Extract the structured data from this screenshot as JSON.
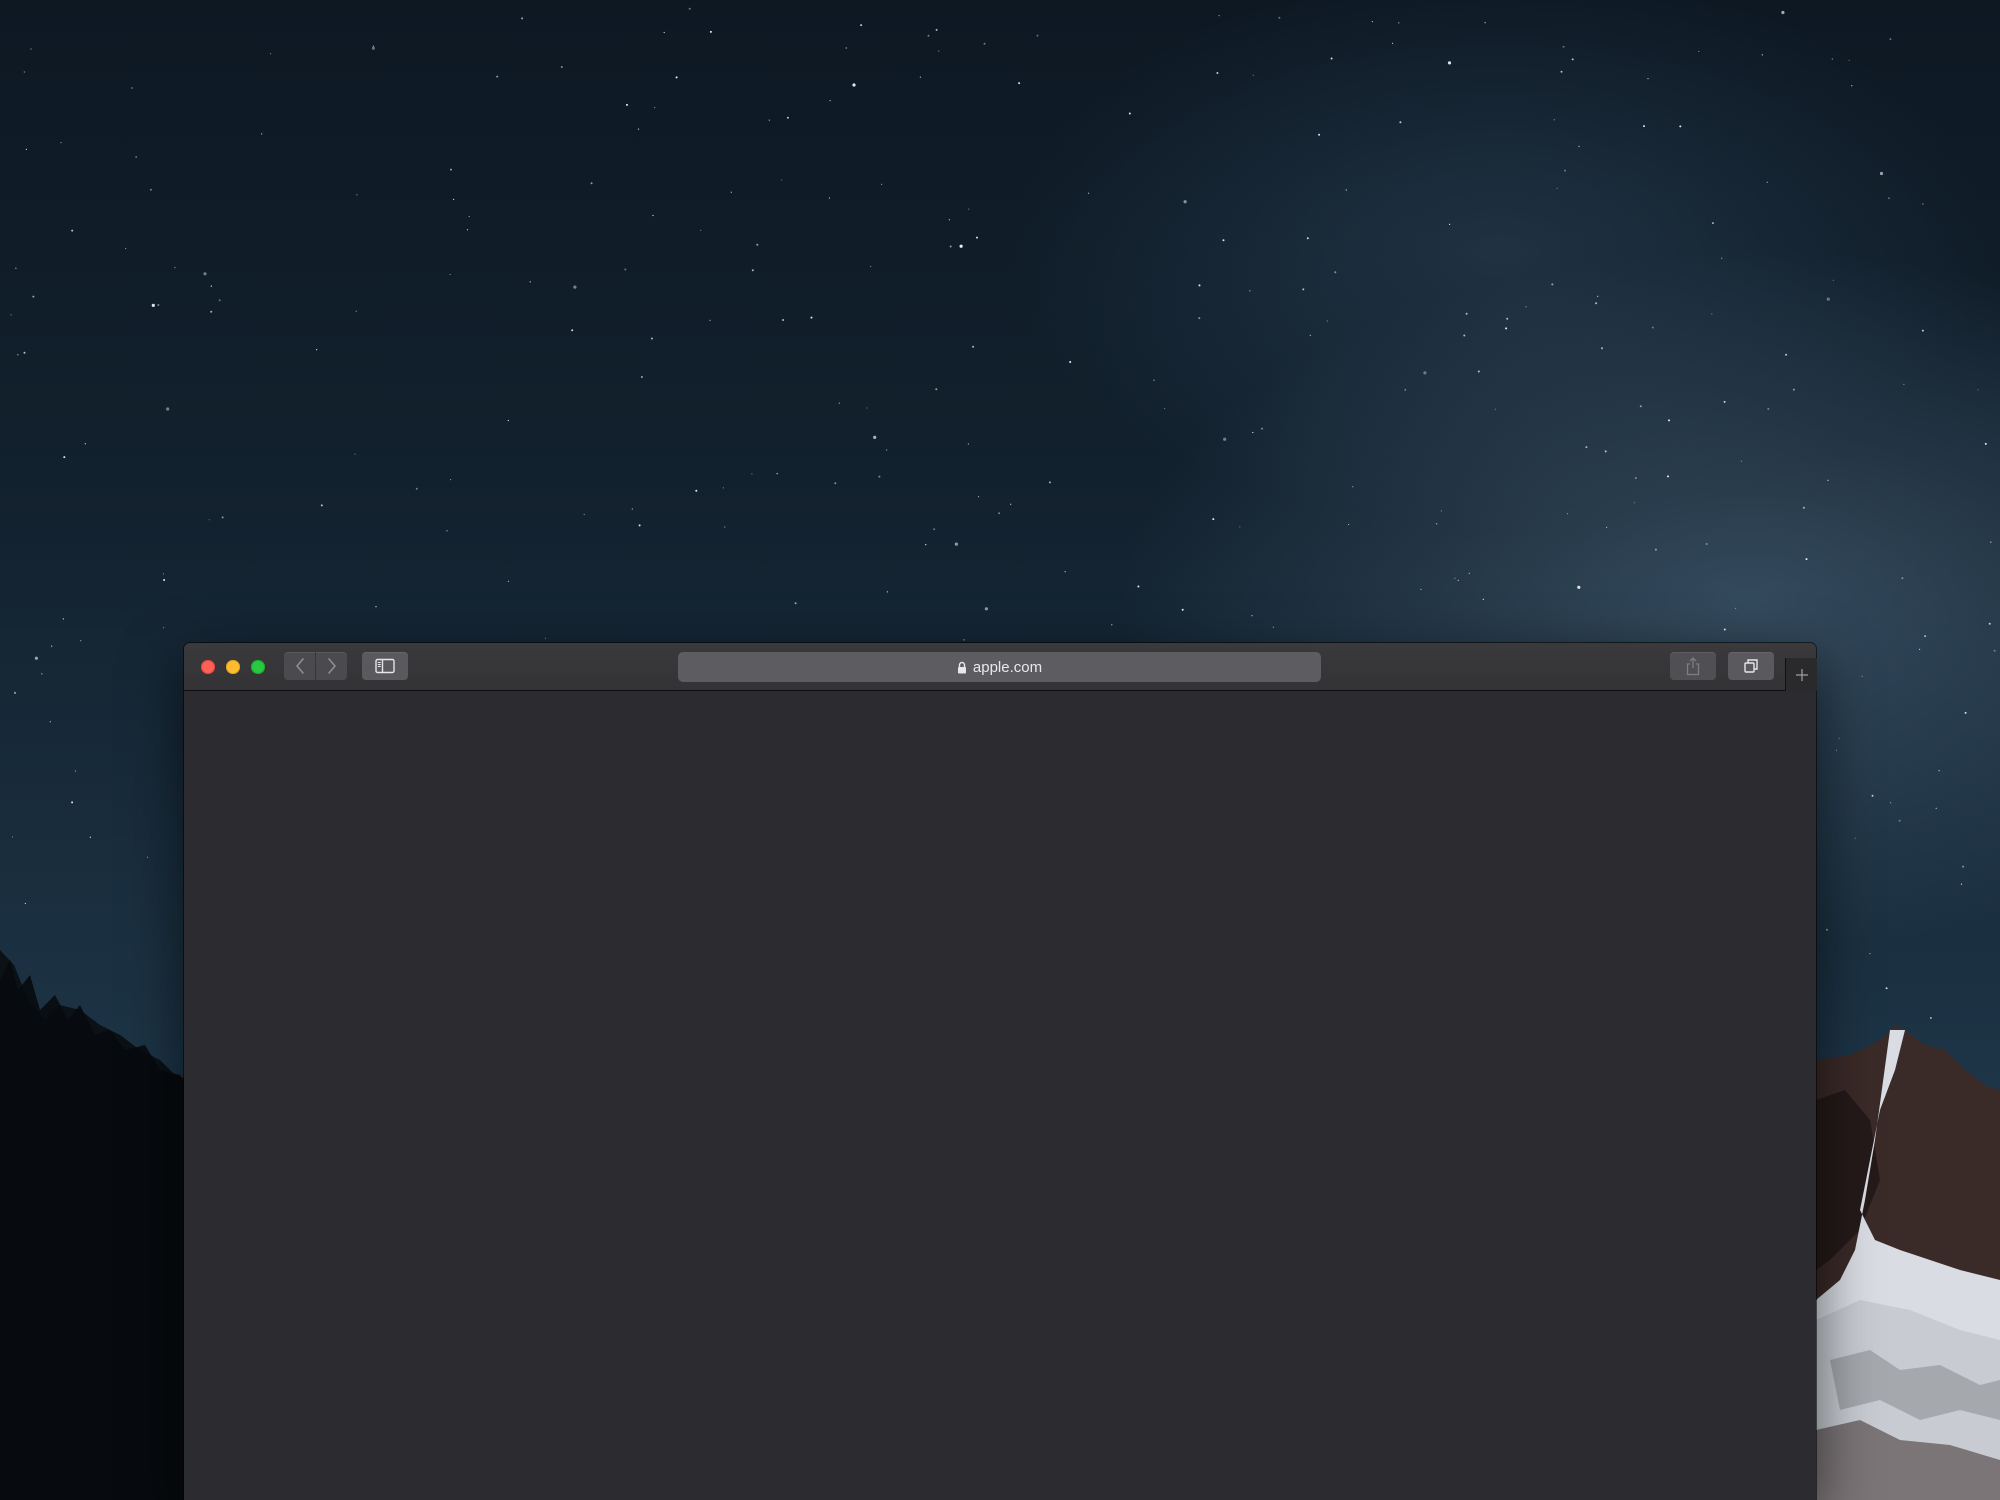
{
  "desktop": {
    "wallpaper": "starry-night-mountains"
  },
  "browser": {
    "window_controls": {
      "close_color": "#fe5f57",
      "minimize_color": "#febc2e",
      "zoom_color": "#28c840"
    },
    "toolbar": {
      "back_icon": "chevron-left-icon",
      "forward_icon": "chevron-right-icon",
      "sidebar_icon": "sidebar-icon",
      "share_icon": "share-icon",
      "tabs_icon": "tab-overview-icon",
      "new_tab_icon": "plus-icon"
    },
    "address_bar": {
      "lock_icon": "lock-icon",
      "url": "apple.com"
    },
    "content": {
      "background": "#2c2c30"
    }
  }
}
